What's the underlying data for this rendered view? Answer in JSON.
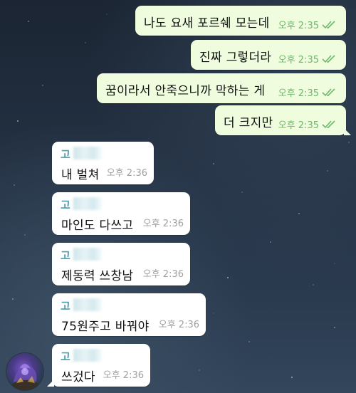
{
  "outgoing": [
    {
      "text": "나도 요새 포르쉐 모는데",
      "time": "오후 2:35"
    },
    {
      "text": "진짜 그렇더라",
      "time": "오후 2:35"
    },
    {
      "text": "꿈이라서 안죽으니까 막하는 게",
      "time": "오후 2:35"
    },
    {
      "text": "더 크지만",
      "time": "오후 2:35"
    }
  ],
  "incoming": [
    {
      "sender": "고",
      "text": "내 벌쳐",
      "time": "오후 2:36"
    },
    {
      "sender": "고",
      "text": "마인도 다쓰고",
      "time": "오후 2:36"
    },
    {
      "sender": "고",
      "text": "제동력 쓰창남",
      "time": "오후 2:36"
    },
    {
      "sender": "고",
      "text": "75원주고 바꿔야",
      "time": "오후 2:36"
    },
    {
      "sender": "고",
      "text": "쓰겄다",
      "time": "오후 2:36"
    }
  ],
  "colors": {
    "outgoing_bubble": "#effdde",
    "incoming_bubble": "#ffffff",
    "read_check": "#6fb86b",
    "sender_name": "#4a9fb0"
  },
  "icons": {
    "read_receipt": "double-check-icon",
    "avatar": "game-character-avatar"
  }
}
